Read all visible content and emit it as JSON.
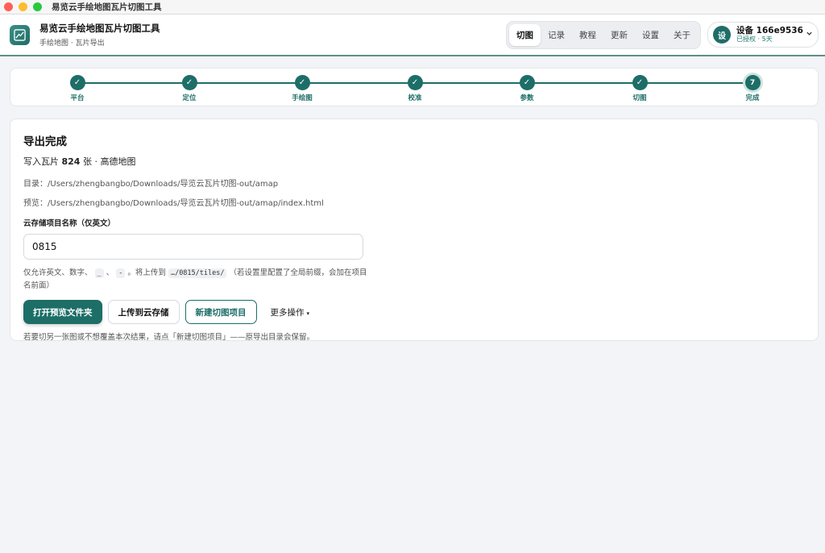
{
  "window": {
    "title": "易览云手绘地图瓦片切图工具"
  },
  "header": {
    "app_name": "易览云手绘地图瓦片切图工具",
    "app_subtitle": "手绘地图 · 瓦片导出",
    "tabs": [
      {
        "label": "切图",
        "active": true
      },
      {
        "label": "记录",
        "active": false
      },
      {
        "label": "教程",
        "active": false
      },
      {
        "label": "更新",
        "active": false
      },
      {
        "label": "设置",
        "active": false
      },
      {
        "label": "关于",
        "active": false
      }
    ],
    "device": {
      "avatar": "设",
      "name": "设备 166e9536",
      "status": "已授权 · 5天"
    }
  },
  "stepper": {
    "steps": [
      {
        "label": "平台",
        "mark": "✓"
      },
      {
        "label": "定位",
        "mark": "✓"
      },
      {
        "label": "手绘图",
        "mark": "✓"
      },
      {
        "label": "校准",
        "mark": "✓"
      },
      {
        "label": "参数",
        "mark": "✓"
      },
      {
        "label": "切图",
        "mark": "✓"
      },
      {
        "label": "完成",
        "mark": "7"
      }
    ]
  },
  "result": {
    "title": "导出完成",
    "summary_prefix": "写入瓦片",
    "tile_count": "824",
    "summary_suffix": "张 · 高德地图",
    "dir_label": "目录：",
    "dir_path": "/Users/zhengbangbo/Downloads/导览云瓦片切图-out/amap",
    "preview_label": "预览：",
    "preview_path": "/Users/zhengbangbo/Downloads/导览云瓦片切图-out/amap/index.html",
    "project_label": "云存储项目名称（仅英文）",
    "project_value": "0815",
    "hint_part1": "仅允许英文、数字、",
    "hint_code1": "_",
    "hint_sep": "、",
    "hint_code2": "-",
    "hint_part2": "。将上传到",
    "hint_code3": "…/0815/tiles/",
    "hint_part3": "（若设置里配置了全局前缀，会加在项目名前面）",
    "btn_open": "打开预览文件夹",
    "btn_upload": "上传到云存储",
    "btn_new": "新建切图项目",
    "more_label": "更多操作",
    "more_caret": "▾",
    "footnote": "若要切另一张图或不想覆盖本次结果，请点「新建切图项目」——原导出目录会保留。"
  },
  "colors": {
    "accent": "#1d6e67",
    "accent_light": "#cfe3df",
    "background": "#f2f4f7"
  },
  "icons": {
    "logo": "map-tiles-icon",
    "chevron": "chevron-down-icon",
    "check": "check-icon"
  }
}
